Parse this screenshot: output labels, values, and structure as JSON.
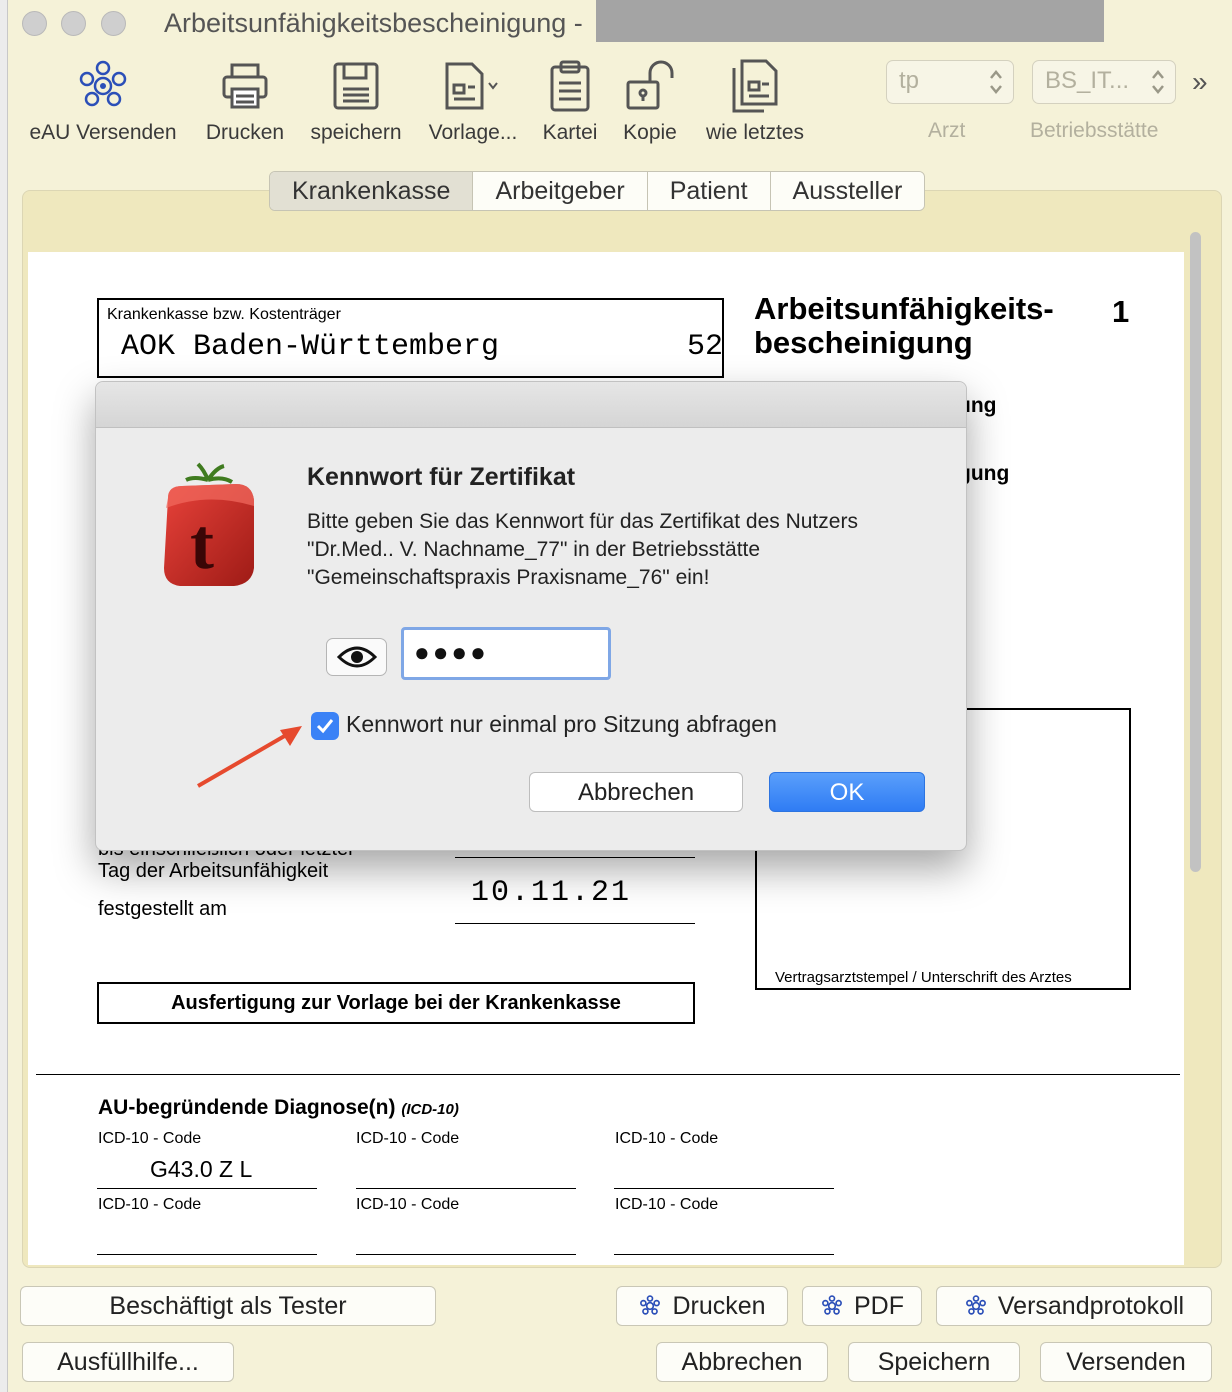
{
  "window": {
    "title": "Arbeitsunfähigkeitsbescheinigung -"
  },
  "toolbar": {
    "items": [
      {
        "label": "eAU Versenden",
        "icon": "eau-logo-icon"
      },
      {
        "label": "Drucken",
        "icon": "printer-icon"
      },
      {
        "label": "speichern",
        "icon": "floppy-disk-icon"
      },
      {
        "label": "Vorlage...",
        "icon": "template-icon"
      },
      {
        "label": "Kartei",
        "icon": "clipboard-icon"
      },
      {
        "label": "Kopie",
        "icon": "unlock-icon"
      },
      {
        "label": "wie letztes",
        "icon": "document-copy-icon"
      }
    ],
    "arzt_value": "tp",
    "arzt_label": "Arzt",
    "betrieb_value": "BS_IT...",
    "betrieb_label": "Betriebsstätte",
    "overflow": "»"
  },
  "tabs": [
    "Krankenkasse",
    "Arbeitgeber",
    "Patient",
    "Aussteller"
  ],
  "active_tab": "Krankenkasse",
  "form": {
    "kasse_label": "Krankenkasse bzw. Kostenträger",
    "kasse_value": "AOK Baden-Württemberg",
    "kasse_number": "52",
    "heading_line1": "Arbeitsunfähigkeits-",
    "heading_line2": "bescheinigung",
    "heading_number": "1",
    "partial_1": "ung",
    "partial_2": "gung",
    "bis_label": "bis einschließlich oder letzter",
    "tag_label": "Tag der Arbeitsunfähigkeit",
    "festgestellt_label": "festgestellt am",
    "festgestellt_value": "10.11.21",
    "stamp_label": "Vertragsarztstempel / Unterschrift des Arztes",
    "ausfertigung": "Ausfertigung zur Vorlage bei der Krankenkasse",
    "diag_title": "AU-begründende Diagnose(n)",
    "diag_sub": "(ICD-10)",
    "icd_label": "ICD-10 - Code",
    "icd_codes": [
      "G43.0 Z L",
      "",
      "",
      "",
      "",
      ""
    ]
  },
  "dialog": {
    "title": "Kennwort für Zertifikat",
    "message": "Bitte geben Sie das Kennwort für das Zertifikat des Nutzers \"Dr.Med.. V. Nachname_77\" in der Betriebsstätte \"Gemeinschaftspraxis Praxisname_76\" ein!",
    "password_mask": "●●●●",
    "checkbox_label": "Kennwort nur einmal pro Sitzung abfragen",
    "checkbox_checked": true,
    "cancel_label": "Abbrechen",
    "ok_label": "OK",
    "logo_letter": "t"
  },
  "bottom": {
    "tester": "Beschäftigt als Tester",
    "ausfuell": "Ausfüllhilfe...",
    "drucken": "Drucken",
    "pdf": "PDF",
    "versandprotokoll": "Versandprotokoll",
    "abbrechen": "Abbrechen",
    "speichern": "Speichern",
    "versenden": "Versenden"
  }
}
